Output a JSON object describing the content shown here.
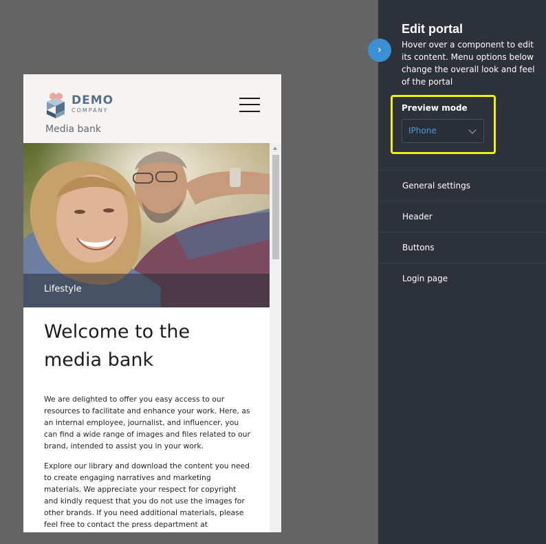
{
  "preview": {
    "logo": {
      "title": "DEMO",
      "subtitle": "COMPANY"
    },
    "breadcrumb": "Media bank",
    "hero_caption": "Lifestyle",
    "heading": "Welcome to the media bank",
    "paragraphs": [
      "We are delighted to offer you easy access to our resources to facilitate and enhance your work. Here, as an internal employee, journalist, and influencer, you can find a wide range of images and files related to our brand, intended to assist you in your work.",
      "Explore our library and download the content you need to create engaging narratives and marketing materials. We appreciate your respect for copyright and kindly request that you do not use the images for other brands. If you need additional materials, please feel free to contact the press department at"
    ]
  },
  "panel": {
    "title": "Edit portal",
    "description": "Hover over a component to edit its content. Menu options below change the overall look and feel of the portal",
    "preview_mode_label": "Preview mode",
    "preview_mode_value": "IPhone",
    "menu": [
      {
        "label": "General settings"
      },
      {
        "label": "Header"
      },
      {
        "label": "Buttons"
      },
      {
        "label": "Login page"
      }
    ],
    "toggle_icon": "chevron-right-icon"
  },
  "colors": {
    "accent": "#3b8fd4",
    "highlight": "#f0f000",
    "panel_bg": "#2d3139",
    "header_bg": "#f6f3f0"
  }
}
